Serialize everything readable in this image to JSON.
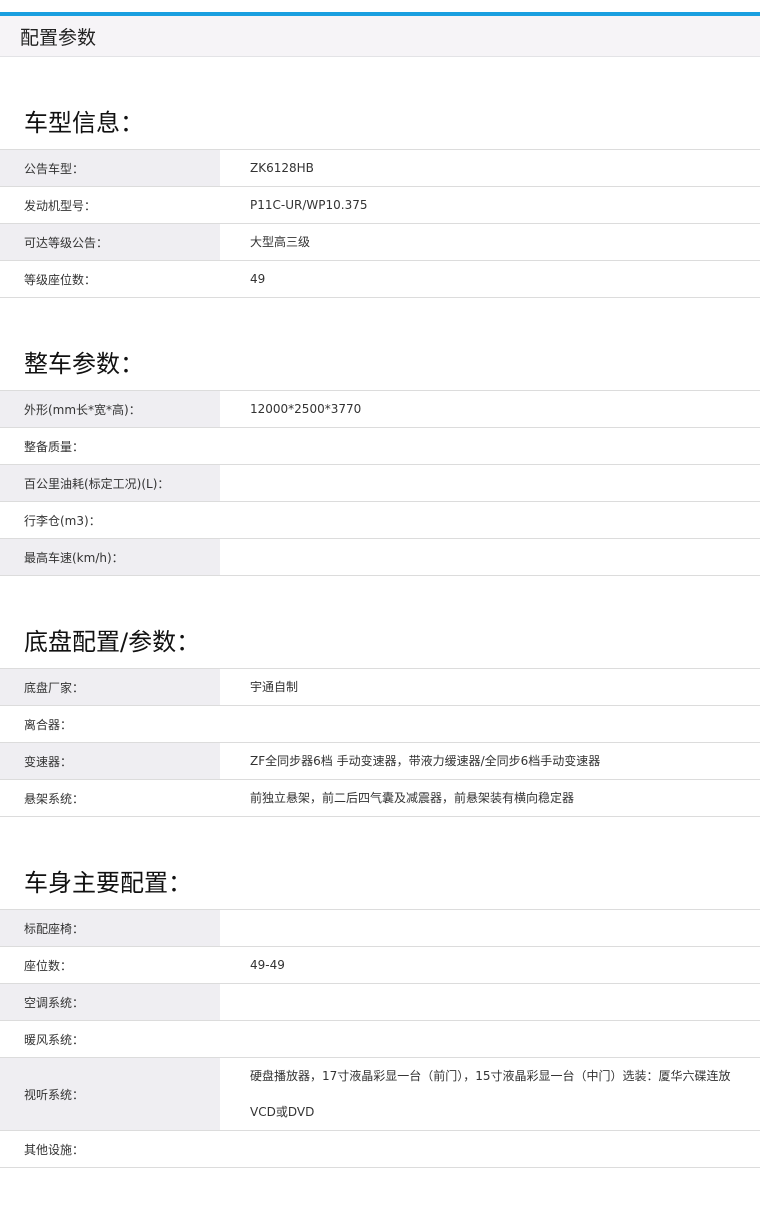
{
  "header": {
    "title": "配置参数"
  },
  "sections": [
    {
      "title": "车型信息：",
      "rows": [
        {
          "label": "公告车型：",
          "value": "ZK6128HB"
        },
        {
          "label": "发动机型号：",
          "value": "P11C-UR/WP10.375"
        },
        {
          "label": "可达等级公告：",
          "value": "大型高三级"
        },
        {
          "label": "等级座位数：",
          "value": "49"
        }
      ]
    },
    {
      "title": "整车参数：",
      "rows": [
        {
          "label": "外形(mm长*宽*高)：",
          "value": "12000*2500*3770"
        },
        {
          "label": "整备质量：",
          "value": ""
        },
        {
          "label": "百公里油耗(标定工况)(L)：",
          "value": ""
        },
        {
          "label": "行李仓(m3)：",
          "value": ""
        },
        {
          "label": "最高车速(km/h)：",
          "value": ""
        }
      ]
    },
    {
      "title": "底盘配置/参数：",
      "rows": [
        {
          "label": "底盘厂家：",
          "value": "宇通自制"
        },
        {
          "label": "离合器：",
          "value": ""
        },
        {
          "label": "变速器：",
          "value": "ZF全同步器6档 手动变速器，带液力缓速器/全同步6档手动变速器"
        },
        {
          "label": "悬架系统：",
          "value": "前独立悬架，前二后四气囊及减震器，前悬架装有横向稳定器"
        }
      ]
    },
    {
      "title": "车身主要配置：",
      "rows": [
        {
          "label": "标配座椅：",
          "value": ""
        },
        {
          "label": "座位数：",
          "value": "49-49"
        },
        {
          "label": "空调系统：",
          "value": ""
        },
        {
          "label": "暖风系统：",
          "value": ""
        },
        {
          "label": "视听系统：",
          "value": "硬盘播放器，17寸液晶彩显一台（前门），15寸液晶彩显一台（中门）选装：厦华六碟连放VCD或DVD"
        },
        {
          "label": "其他设施：",
          "value": ""
        }
      ]
    }
  ]
}
